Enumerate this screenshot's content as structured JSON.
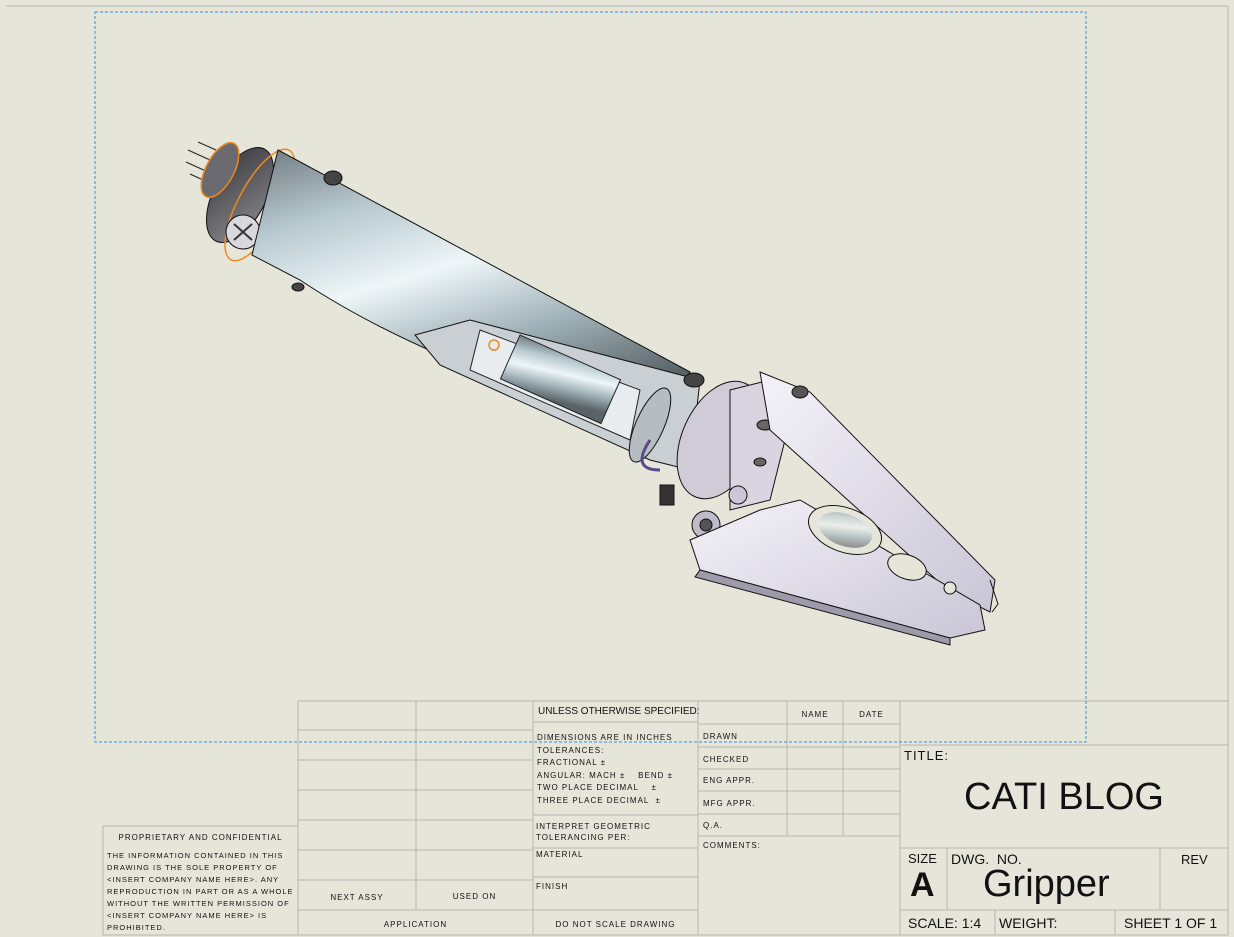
{
  "view": {
    "name": "drawing-view-isometric",
    "accent_highlight_color": "#f08a1c",
    "view_boundary_color": "#3a8fd8"
  },
  "revision_block": {
    "next_assy_label": "NEXT ASSY",
    "used_on_label": "USED ON",
    "application_label": "APPLICATION"
  },
  "tolerances": {
    "header": "UNLESS OTHERWISE SPECIFIED:",
    "dimensions": "DIMENSIONS ARE IN INCHES",
    "tolerances": "TOLERANCES:",
    "fractional": "FRACTIONAL ±",
    "angular": "ANGULAR: MACH ±    BEND ±",
    "two_place": "TWO PLACE DECIMAL    ±",
    "three_place": "THREE PLACE DECIMAL  ±",
    "interpret1": "INTERPRET GEOMETRIC",
    "interpret2": "TOLERANCING PER:",
    "material": "MATERIAL",
    "finish": "FINISH",
    "do_not_scale": "DO NOT SCALE DRAWING"
  },
  "approvals": {
    "name_header": "NAME",
    "date_header": "DATE",
    "drawn": "DRAWN",
    "checked": "CHECKED",
    "eng_appr": "ENG APPR.",
    "mfg_appr": "MFG APPR.",
    "qa": "Q.A.",
    "comments": "COMMENTS:"
  },
  "title_block": {
    "title_label": "TITLE:",
    "title": "CATI BLOG",
    "size_label": "SIZE",
    "size": "A",
    "dwg_no_label": "DWG.  NO.",
    "dwg_no": "Gripper",
    "rev_label": "REV",
    "scale": "SCALE: 1:4",
    "weight": "WEIGHT:",
    "sheet": "SHEET 1 OF 1"
  },
  "proprietary": {
    "heading": "PROPRIETARY AND CONFIDENTIAL",
    "lines": [
      "THE INFORMATION CONTAINED IN THIS",
      "DRAWING IS THE SOLE PROPERTY OF",
      "<INSERT COMPANY NAME HERE>.  ANY",
      "REPRODUCTION IN PART OR AS A WHOLE",
      "WITHOUT THE WRITTEN PERMISSION OF",
      "<INSERT COMPANY NAME HERE> IS",
      "PROHIBITED."
    ]
  }
}
